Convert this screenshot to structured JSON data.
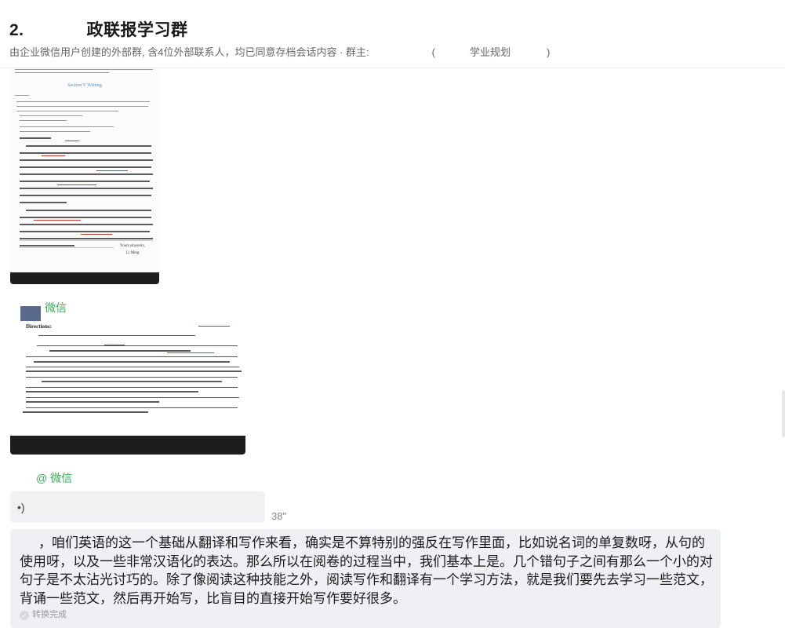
{
  "header": {
    "title_left": "2.",
    "title_right": "政联报学习群",
    "subtitle_left": "由企业微信用户创建的外部群, 含4位外部联系人，均已同意存档会话内容",
    "subtitle_owner_prefix": "· 群主:",
    "subtitle_owner_open": "(",
    "subtitle_owner_tag": "学业规划",
    "subtitle_owner_close": ")"
  },
  "messages": {
    "image1": {
      "section_title": "Section V Writing",
      "signoff_1": "Yours sincerely,",
      "signoff_2": "Li Ming"
    },
    "sender2": {
      "name": "微信"
    },
    "image2": {
      "directions": "Directions:"
    },
    "sender3": {
      "name": "@ 微信"
    },
    "voice": {
      "duration": "38\""
    },
    "transcript": {
      "text": "，咱们英语的这一个基础从翻译和写作来看，确实是不算特别的强反在写作里面，比如说名词的单复数呀，从句的使用呀，以及一些非常汉语化的表达。那么所以在阅卷的过程当中，我们基本上是。几个错句子之间有那么一个小的对句子是不太沾光讨巧的。除了像阅读这种技能之外，阅读写作和翻译有一个学习方法，就是我们要先去学习一些范文，背诵一些范文，然后再开始写，比盲目的直接开始写作要好很多。",
      "status": "转换完成"
    }
  },
  "icons": {
    "voice": "voice-wave-icon",
    "check": "check-circle-icon",
    "avatar": "avatar"
  },
  "colors": {
    "sender_name": "#3aa856",
    "bubble": "#eef0f3",
    "header_text": "#1a1a1a"
  }
}
